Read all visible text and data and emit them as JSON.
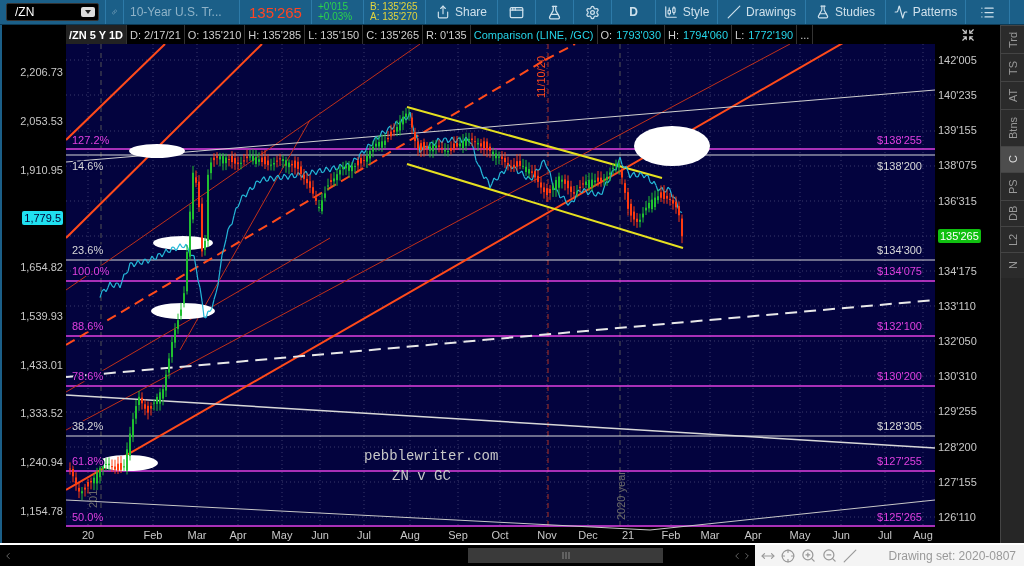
{
  "toolbar": {
    "symbol": "/ZN",
    "description": "10-Year U.S. Tr...",
    "last": "135'265",
    "change": "+0'015",
    "change_pct": "+0.03%",
    "bid": "B: 135'265",
    "ask": "A: 135'270",
    "share": "Share",
    "aggregation": "D",
    "menus": [
      "Style",
      "Drawings",
      "Studies",
      "Patterns"
    ]
  },
  "info_bar": [
    {
      "kind": "title",
      "text": "/ZN 5 Y 1D"
    },
    {
      "kind": "plain",
      "text": "D: 2/17/21"
    },
    {
      "kind": "plain",
      "text": "O: 135'210"
    },
    {
      "kind": "plain",
      "text": "H: 135'285"
    },
    {
      "kind": "plain",
      "text": "L: 135'150"
    },
    {
      "kind": "plain",
      "text": "C: 135'265"
    },
    {
      "kind": "plain",
      "text": "R: 0'135"
    },
    {
      "kind": "comparison",
      "text": "Comparison (LINE, /GC)"
    },
    {
      "kind": "pair",
      "label": "O:",
      "value": "1793'030"
    },
    {
      "kind": "pair",
      "label": "H:",
      "value": "1794'060"
    },
    {
      "kind": "pair",
      "label": "L:",
      "value": "1772'190"
    },
    {
      "kind": "more",
      "text": "..."
    }
  ],
  "left_axis": [
    {
      "kind": "tick",
      "text": "2,206.73"
    },
    {
      "kind": "tick",
      "text": "2,053.53"
    },
    {
      "kind": "tick",
      "text": "1,910.95"
    },
    {
      "kind": "current",
      "text": "1,779.5"
    },
    {
      "kind": "tick",
      "text": "1,654.82"
    },
    {
      "kind": "tick",
      "text": "1,539.93"
    },
    {
      "kind": "tick",
      "text": "1,433.01"
    },
    {
      "kind": "tick",
      "text": "1,333.52"
    },
    {
      "kind": "tick",
      "text": "1,240.94"
    },
    {
      "kind": "tick",
      "text": "1,154.78"
    }
  ],
  "right_axis": [
    {
      "kind": "tick",
      "text": "142'005"
    },
    {
      "kind": "tick",
      "text": "140'235"
    },
    {
      "kind": "tick",
      "text": "139'155"
    },
    {
      "kind": "tick",
      "text": "138'075"
    },
    {
      "kind": "tick",
      "text": "136'315"
    },
    {
      "kind": "current",
      "text": "135'265"
    },
    {
      "kind": "tick",
      "text": "134'175"
    },
    {
      "kind": "tick",
      "text": "133'110"
    },
    {
      "kind": "tick",
      "text": "132'050"
    },
    {
      "kind": "tick",
      "text": "130'310"
    },
    {
      "kind": "tick",
      "text": "129'255"
    },
    {
      "kind": "tick",
      "text": "128'200"
    },
    {
      "kind": "tick",
      "text": "127'155"
    },
    {
      "kind": "tick",
      "text": "126'110"
    }
  ],
  "chart": {
    "levels": [
      {
        "left_label": "127.2%",
        "right_label": "$138'255",
        "color": "#e040e0"
      },
      {
        "left_label": "14.6%",
        "right_label": "$138'200",
        "color": "#d8d8d8"
      },
      {
        "left_label": "23.6%",
        "right_label": "$134'300",
        "color": "#d8d8d8"
      },
      {
        "left_label": "100.0%",
        "right_label": "$134'075",
        "color": "#e040e0"
      },
      {
        "left_label": "88.6%",
        "right_label": "$132'100",
        "color": "#e040e0"
      },
      {
        "left_label": "78.6%",
        "right_label": "$130'200",
        "color": "#e040e0"
      },
      {
        "left_label": "38.2%",
        "right_label": "$128'305",
        "color": "#d8d8d8"
      },
      {
        "left_label": "61.8%",
        "right_label": "$127'255",
        "color": "#e040e0"
      },
      {
        "left_label": "50.0%",
        "right_label": "$125'265",
        "color": "#e040e0"
      }
    ],
    "vertical_notes": [
      {
        "kind": "date",
        "text": "11/10/20"
      },
      {
        "kind": "year",
        "text": "2020 year"
      },
      {
        "kind": "year_start",
        "text": "201"
      }
    ],
    "caption": [
      "pebblewriter.com",
      "ZN v GC"
    ],
    "x_labels": [
      "20",
      "Feb",
      "Mar",
      "Apr",
      "May",
      "Jun",
      "Jul",
      "Aug",
      "Sep",
      "Oct",
      "Nov",
      "Dec",
      "21",
      "Feb",
      "Mar",
      "Apr",
      "May",
      "Jun",
      "Jul",
      "Aug"
    ]
  },
  "side_tabs": [
    {
      "label": "Trd",
      "selected": false
    },
    {
      "label": "TS",
      "selected": false
    },
    {
      "label": "AT",
      "selected": false
    },
    {
      "label": "Btns",
      "selected": false
    },
    {
      "label": "C",
      "selected": true
    },
    {
      "label": "PS",
      "selected": false
    },
    {
      "label": "DB",
      "selected": false
    },
    {
      "label": "L2",
      "selected": false
    },
    {
      "label": "N",
      "selected": false
    }
  ],
  "bottom_bar": {
    "drawing_set": "Drawing set: 2020-0807"
  }
}
